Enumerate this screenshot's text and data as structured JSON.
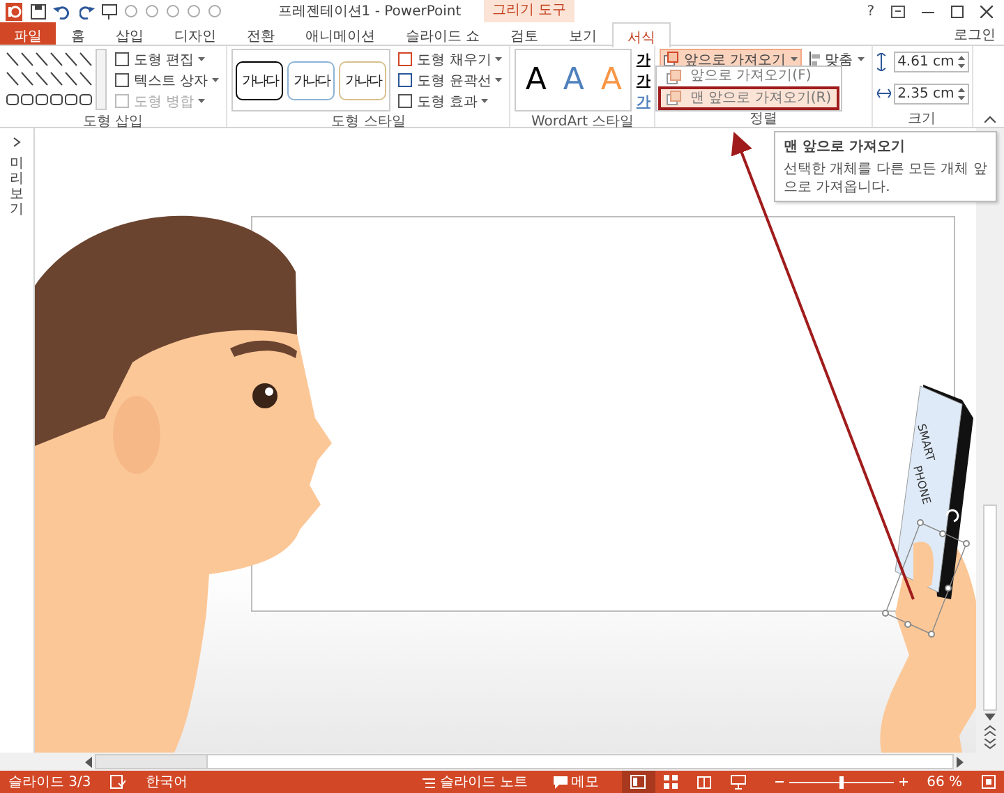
{
  "window": {
    "title": "프레젠테이션1 - PowerPoint",
    "context_label": "그리기 도구",
    "help": "?",
    "sign_in": "로그인"
  },
  "tabs": [
    {
      "label": "파일",
      "kind": "file",
      "selected": false
    },
    {
      "label": "홈",
      "kind": "normal",
      "selected": false
    },
    {
      "label": "삽입",
      "kind": "normal",
      "selected": false
    },
    {
      "label": "디자인",
      "kind": "normal",
      "selected": false
    },
    {
      "label": "전환",
      "kind": "normal",
      "selected": false
    },
    {
      "label": "애니메이션",
      "kind": "normal",
      "selected": false
    },
    {
      "label": "슬라이드 쇼",
      "kind": "normal",
      "selected": false
    },
    {
      "label": "검토",
      "kind": "normal",
      "selected": false
    },
    {
      "label": "보기",
      "kind": "normal",
      "selected": false
    },
    {
      "label": "서식",
      "kind": "context",
      "selected": true
    }
  ],
  "shape_insert": {
    "label": "도형 삽입",
    "commands": [
      {
        "label": "도형 편집",
        "disabled": false
      },
      {
        "label": "텍스트 상자",
        "disabled": false
      },
      {
        "label": "도형 병합",
        "disabled": true
      }
    ]
  },
  "shape_styles": {
    "label": "도형 스타일",
    "presets": [
      {
        "text": "가나다",
        "color": "#000000"
      },
      {
        "text": "가나다",
        "color": "#8db3d6"
      },
      {
        "text": "가나다",
        "color": "#d9c08f"
      }
    ],
    "commands": [
      {
        "label": "도형 채우기",
        "disabled": false
      },
      {
        "label": "도형 윤곽선",
        "disabled": false
      },
      {
        "label": "도형 효과",
        "disabled": false
      }
    ]
  },
  "wordart_styles": {
    "label": "WordArt 스타일",
    "letters": [
      {
        "text": "A",
        "color": "#000000"
      },
      {
        "text": "A",
        "color": "#4f81bd"
      },
      {
        "text": "A",
        "color": "#f79646"
      }
    ],
    "text_buttons": [
      {
        "text": "가",
        "color": "#000000"
      },
      {
        "text": "가",
        "color": "#000000"
      },
      {
        "text": "가",
        "color": "#4f81bd"
      }
    ]
  },
  "arrange": {
    "label": "정렬",
    "bring_forward": "앞으로 가져오기",
    "align": "맞춤",
    "menu": [
      {
        "label": "앞으로 가져오기(F)",
        "selected": false
      },
      {
        "label": "맨 앞으로 가져오기(R)",
        "selected": true
      }
    ]
  },
  "size": {
    "label": "크기",
    "height": "4.61 cm",
    "width": "2.35 cm"
  },
  "tooltip": {
    "title": "맨 앞으로 가져오기",
    "body": "선택한 개체를 다른 모든 개체 앞으로 가져옵니다."
  },
  "thumbnail_pane": {
    "label": "미리 보기"
  },
  "slide": {
    "phone_text": [
      "SMART",
      "PHONE"
    ]
  },
  "status_bar": {
    "slide": "슬라이드 3/3",
    "language": "한국어",
    "notes": "슬라이드 노트",
    "comments": "메모",
    "views": [
      {
        "kind": "normal",
        "selected": true
      },
      {
        "kind": "sorter",
        "selected": false
      },
      {
        "kind": "reading",
        "selected": false
      },
      {
        "kind": "show",
        "selected": false
      }
    ],
    "zoom": "66 %",
    "level": 0.5
  }
}
